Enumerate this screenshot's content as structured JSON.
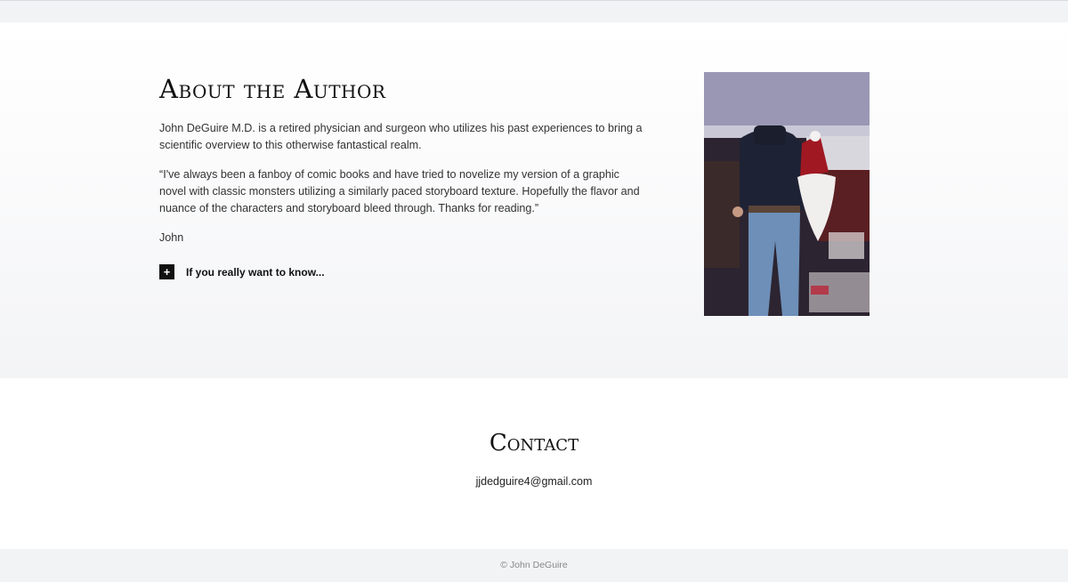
{
  "about": {
    "title": "About the Author",
    "paragraph1": "John DeGuire M.D. is a retired physician and surgeon who utilizes his past experiences to bring a scientific overview to this otherwise fantastical realm.",
    "paragraph2": "“I've always been a fanboy of comic books and have tried to novelize my version of a graphic novel with classic monsters utilizing a similarly paced storyboard texture. Hopefully the flavor and nuance of the characters and storyboard bleed through. Thanks for reading.”",
    "signature": "John",
    "toggle_icon": "+",
    "toggle_label": "If you really want to know..."
  },
  "contact": {
    "title": "Contact",
    "email": "jjdedguire4@gmail.com"
  },
  "footer": {
    "copyright": "© John DeGuire"
  },
  "colors": {
    "band_background": "#f2f3f5",
    "text": "#222222",
    "toggle_box": "#111111"
  }
}
